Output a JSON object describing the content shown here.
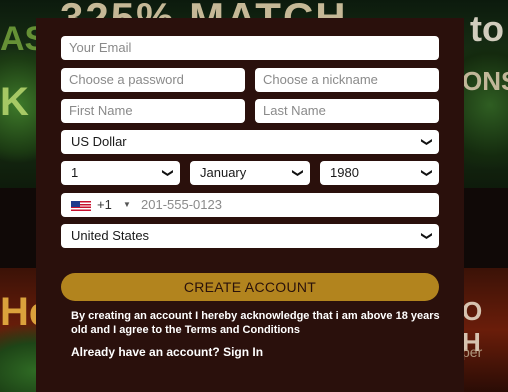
{
  "background": {
    "headline": "325% MATCH",
    "right_top": "to",
    "right_mid": "ONS",
    "left_top": "AS",
    "left_mid": "K",
    "left_bottom": "He",
    "right_bottom": "O H",
    "right_small": "per"
  },
  "form": {
    "email_placeholder": "Your Email",
    "password_placeholder": "Choose a password",
    "nickname_placeholder": "Choose a nickname",
    "first_name_placeholder": "First Name",
    "last_name_placeholder": "Last Name",
    "currency_value": "US Dollar",
    "dob_day_value": "1",
    "dob_month_value": "January",
    "dob_year_value": "1980",
    "phone_country_code": "+1",
    "phone_placeholder": "201-555-0123",
    "country_value": "United States",
    "create_button_label": "CREATE ACCOUNT",
    "legal_text": "By creating an account I hereby acknowledge that i am above 18 years old and I agree to the ",
    "terms_link": "Terms and Conditions",
    "signin_prompt": "Already have an account? ",
    "signin_link": "Sign In"
  },
  "colors": {
    "panel": "#2a100c",
    "button": "#b2841e"
  },
  "icons": {
    "select_chevron": "chevron-down-icon",
    "flag": "us-flag-icon"
  }
}
